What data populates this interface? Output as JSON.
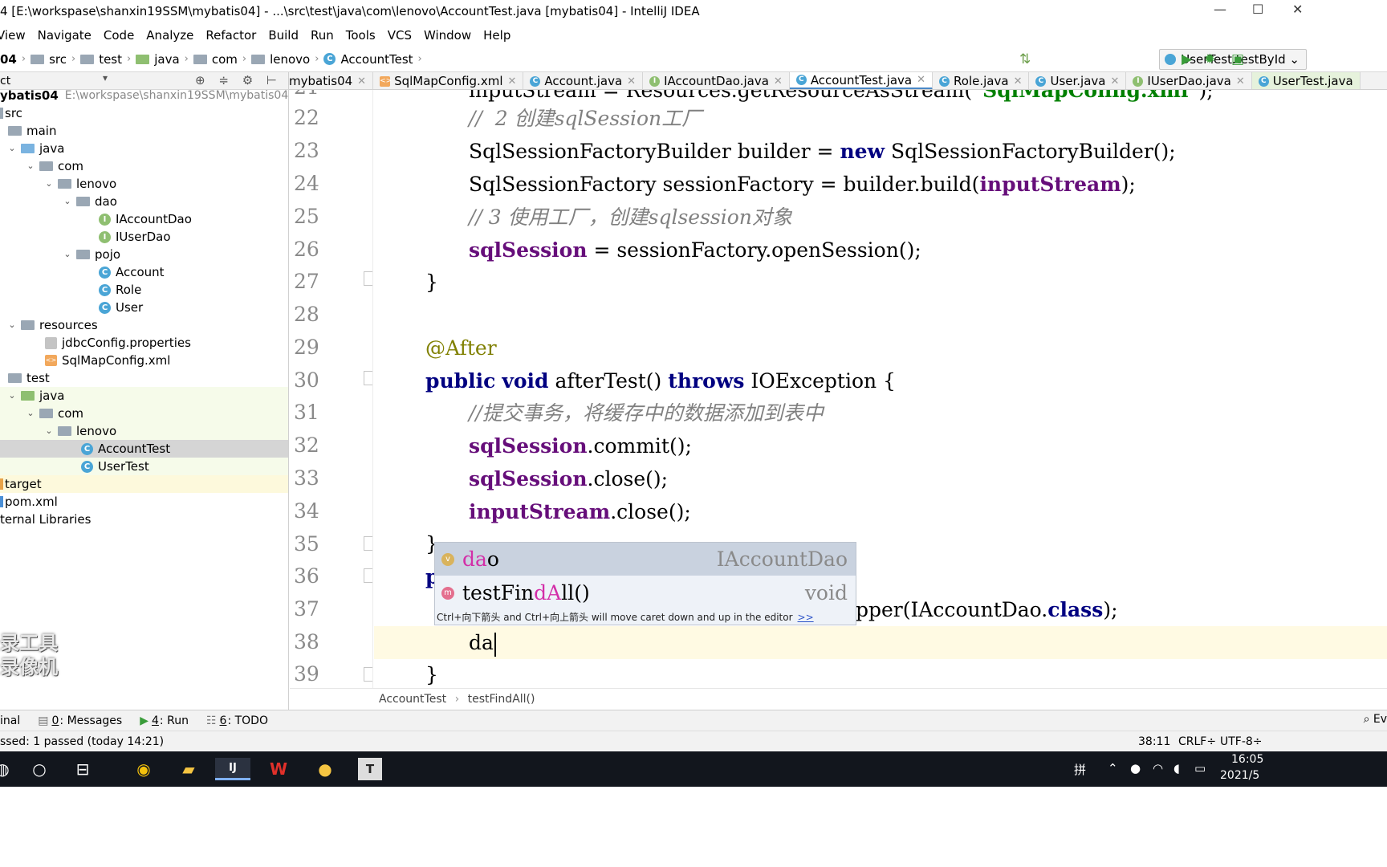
{
  "window": {
    "title": "4 [E:\\workspase\\shanxin19SSM\\mybatis04] - ...\\src\\test\\java\\com\\lenovo\\AccountTest.java [mybatis04] - IntelliJ IDEA"
  },
  "menu": [
    "View",
    "Navigate",
    "Code",
    "Analyze",
    "Refactor",
    "Build",
    "Run",
    "Tools",
    "VCS",
    "Window",
    "Help"
  ],
  "navbar": {
    "crumbs": [
      "04",
      "src",
      "test",
      "java",
      "com",
      "lenovo",
      "AccountTest"
    ],
    "run_config": "UserTest.testById"
  },
  "project_panel": {
    "label": "ct"
  },
  "tabs": [
    {
      "label": "mybatis04",
      "icon": "maven-icon"
    },
    {
      "label": "SqlMapConfig.xml",
      "icon": "xml-icon"
    },
    {
      "label": "Account.java",
      "icon": "class-icon"
    },
    {
      "label": "IAccountDao.java",
      "icon": "interface-icon"
    },
    {
      "label": "AccountTest.java",
      "icon": "class-icon"
    },
    {
      "label": "Role.java",
      "icon": "class-icon"
    },
    {
      "label": "User.java",
      "icon": "class-icon"
    },
    {
      "label": "IUserDao.java",
      "icon": "interface-icon"
    },
    {
      "label": "UserTest.java",
      "icon": "class-icon"
    }
  ],
  "tree": [
    {
      "label": "ybatis04",
      "path": "E:\\workspase\\shanxin19SSM\\mybatis04",
      "icon": "module-icon",
      "arrow": ""
    },
    {
      "label": "src",
      "icon": "folder-icon",
      "arrow": ""
    },
    {
      "label": "main",
      "icon": "folder-icon",
      "arrow": ""
    },
    {
      "label": "java",
      "icon": "source-folder-icon",
      "arrow": "v"
    },
    {
      "label": "com",
      "icon": "package-icon",
      "arrow": "v"
    },
    {
      "label": "lenovo",
      "icon": "package-icon",
      "arrow": "v"
    },
    {
      "label": "dao",
      "icon": "package-icon",
      "arrow": "v"
    },
    {
      "label": "IAccountDao",
      "icon": "interface-icon",
      "arrow": ""
    },
    {
      "label": "IUserDao",
      "icon": "interface-icon",
      "arrow": ""
    },
    {
      "label": "pojo",
      "icon": "package-icon",
      "arrow": "v"
    },
    {
      "label": "Account",
      "icon": "class-icon",
      "arrow": ""
    },
    {
      "label": "Role",
      "icon": "class-icon",
      "arrow": ""
    },
    {
      "label": "User",
      "icon": "class-icon",
      "arrow": ""
    },
    {
      "label": "resources",
      "icon": "resources-folder-icon",
      "arrow": "v"
    },
    {
      "label": "jdbcConfig.properties",
      "icon": "properties-icon",
      "arrow": ""
    },
    {
      "label": "SqlMapConfig.xml",
      "icon": "xml-icon",
      "arrow": ""
    },
    {
      "label": "test",
      "icon": "folder-icon",
      "arrow": ""
    },
    {
      "label": "java",
      "icon": "test-folder-icon",
      "arrow": "v"
    },
    {
      "label": "com",
      "icon": "package-icon",
      "arrow": "v"
    },
    {
      "label": "lenovo",
      "icon": "package-icon",
      "arrow": "v"
    },
    {
      "label": "AccountTest",
      "icon": "test-class-icon",
      "arrow": ""
    },
    {
      "label": "UserTest",
      "icon": "test-class-icon",
      "arrow": ""
    },
    {
      "label": "target",
      "icon": "target-folder-icon",
      "arrow": ""
    },
    {
      "label": "pom.xml",
      "icon": "maven-icon",
      "arrow": ""
    },
    {
      "label": "ternal Libraries",
      "icon": "library-icon",
      "arrow": ""
    }
  ],
  "editor": {
    "line_numbers": [
      "21",
      "22",
      "23",
      "24",
      "25",
      "26",
      "27",
      "28",
      "29",
      "30",
      "31",
      "32",
      "33",
      "34",
      "35",
      "36",
      "37",
      "38",
      "39"
    ],
    "code": {
      "l21a": "inputStream = Resources.getResourceAsStream(",
      "l21b": "\"SqlMapConfig.xml\"",
      "l21c": ");",
      "l22": "//  2 创建sqlSession工厂",
      "l23a": "SqlSessionFactoryBuilder builder = ",
      "l23kw": "new",
      "l23b": " SqlSessionFactoryBuilder();",
      "l24a": "SqlSessionFactory sessionFactory = builder.build(",
      "l24f": "inputStream",
      "l24b": ");",
      "l25": "// 3 使用工厂，创建sqlsession对象",
      "l26f": "sqlSession",
      "l26b": " = sessionFactory.openSession();",
      "l27": "}",
      "l29": "@After",
      "l30kw1": "public",
      "l30kw2": "void",
      "l30b": " afterTest() ",
      "l30kw3": "throws",
      "l30c": " IOException {",
      "l31": "//提交事务，将缓存中的数据添加到表中",
      "l32f": "sqlSession",
      "l32b": ".commit();",
      "l33f": "sqlSession",
      "l33b": ".close();",
      "l34f": "inputStream",
      "l34b": ".close();",
      "l35": "}",
      "l36": "p",
      "l37a": "pper(IAccountDao.",
      "l37kw": "class",
      "l37b": ");",
      "l38": "da",
      "l39": "}"
    },
    "breadcrumbs": [
      "AccountTest",
      "testFindAll()"
    ]
  },
  "autocomplete": {
    "items": [
      {
        "match": "da",
        "rest": "o",
        "type": "IAccountDao",
        "icon": "variable-icon"
      },
      {
        "match_parts": [
          "testFin",
          "dA",
          "ll()"
        ],
        "type": "void",
        "icon": "method-icon"
      }
    ],
    "hint": "Ctrl+向下箭头 and Ctrl+向上箭头 will move caret down and up in the editor",
    "hint_link": ">>"
  },
  "tool_windows": [
    {
      "label": "inal",
      "key": ""
    },
    {
      "label": "Messages",
      "key": "0"
    },
    {
      "label": "Run",
      "key": "4"
    },
    {
      "label": "TODO",
      "key": "6"
    }
  ],
  "status": {
    "message": "ssed: 1 passed (today 14:21)",
    "position": "38:11",
    "line_sep": "CRLF÷",
    "encoding": "UTF-8÷",
    "event_log": "Ev"
  },
  "taskbar": {
    "ime": "拼",
    "time": "16:05",
    "date": "2021/5"
  },
  "watermark": [
    "录工具",
    "录像机"
  ],
  "colors": {
    "keyword": "#000080",
    "field": "#660e7a",
    "comment": "#808080",
    "annotation": "#808000",
    "string": "#008000",
    "current_line": "#fffae3",
    "popup_selected": "#c9d2df"
  }
}
